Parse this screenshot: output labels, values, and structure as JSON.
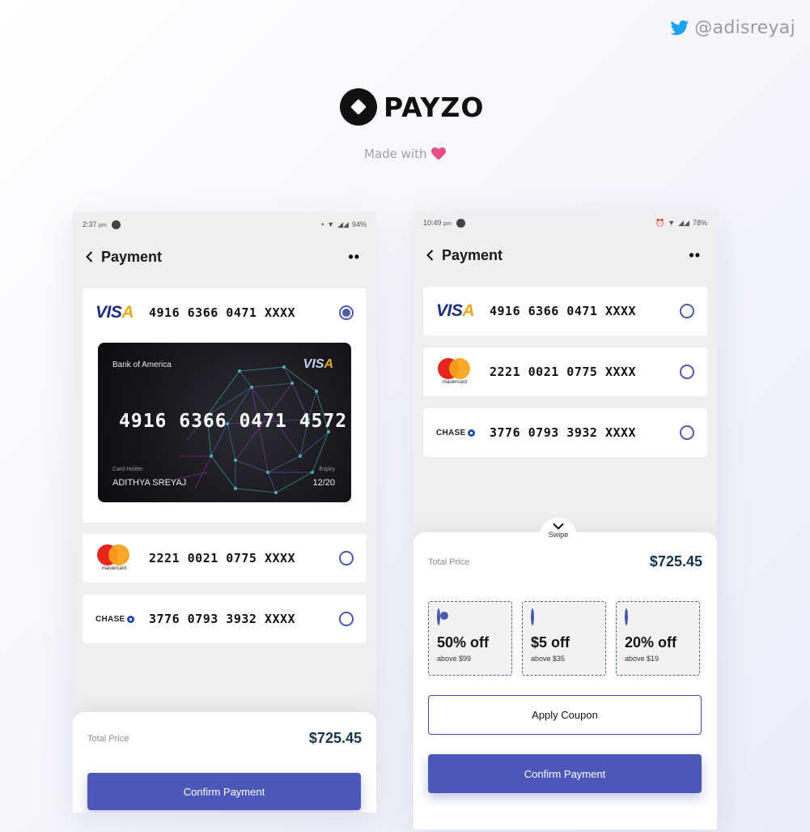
{
  "header": {
    "twitter_handle": "@adisreyaj",
    "brand_name": "PAYZO",
    "made_with": "Made with"
  },
  "phone1": {
    "status": {
      "time": "2:37",
      "time_suffix": "pm",
      "battery": "94%"
    },
    "title": "Payment",
    "cards": [
      {
        "brand": "VISA",
        "number": "4916 6366 0471 XXXX",
        "selected": true
      },
      {
        "brand": "mastercard",
        "number": "2221 0021 0775 XXXX",
        "selected": false
      },
      {
        "brand": "CHASE",
        "number": "3776 0793 3932 XXXX",
        "selected": false
      }
    ],
    "big_card": {
      "bank": "Bank of America",
      "brand": "VISA",
      "number": "4916 6366 0471 4572",
      "holder_label": "Card Holder",
      "holder_name": "ADITHYA SREYAJ",
      "expiry_label": "Expiry",
      "expiry": "12/20"
    },
    "total_label": "Total Price",
    "total_value": "$725.45",
    "confirm_label": "Confirm Payment"
  },
  "phone2": {
    "status": {
      "time": "10:49",
      "time_suffix": "pm",
      "battery": "78%"
    },
    "title": "Payment",
    "cards": [
      {
        "brand": "VISA",
        "number": "4916 6366 0471 XXXX",
        "selected": false
      },
      {
        "brand": "mastercard",
        "number": "2221 0021 0775 XXXX",
        "selected": false
      },
      {
        "brand": "CHASE",
        "number": "3776 0793 3932 XXXX",
        "selected": false
      }
    ],
    "swipe_label": "Swipe",
    "total_label": "Total Price",
    "total_value": "$725.45",
    "coupons": [
      {
        "amount": "50% off",
        "condition": "above $99",
        "selected": true
      },
      {
        "amount": "$5 off",
        "condition": "above $35",
        "selected": false
      },
      {
        "amount": "20% off",
        "condition": "above $19",
        "selected": false
      }
    ],
    "apply_label": "Apply Coupon",
    "confirm_label": "Confirm Payment"
  },
  "colors": {
    "primary": "#4b58b8",
    "price": "#163447",
    "twitter": "#1da1f2",
    "heart": "#ec4c89"
  }
}
